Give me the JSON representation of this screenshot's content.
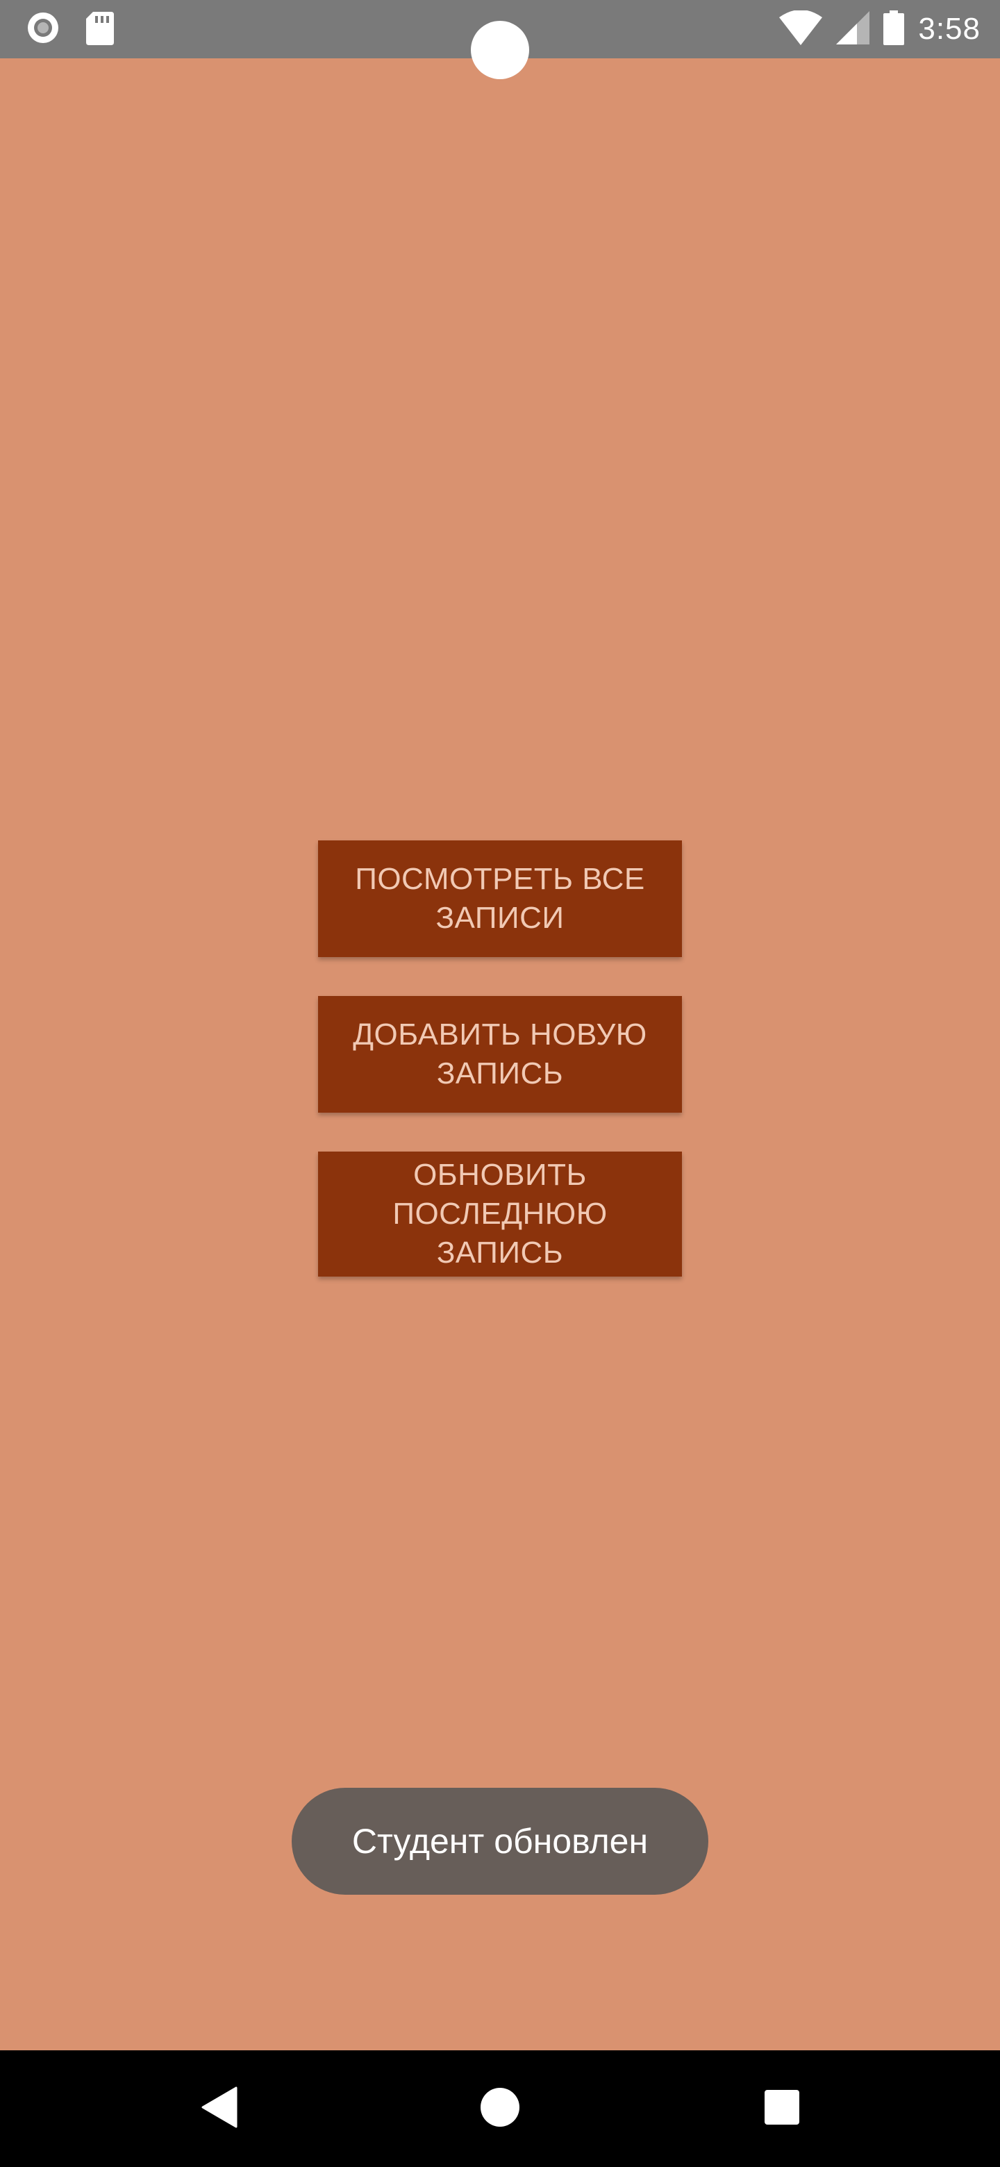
{
  "status_bar": {
    "time": "3:58",
    "icons": [
      "sync-icon",
      "sd-card-icon",
      "wifi-icon",
      "signal-icon",
      "battery-icon"
    ]
  },
  "main": {
    "buttons": [
      {
        "label": "Посмотреть все записи"
      },
      {
        "label": "Добавить новую запись"
      },
      {
        "label": "Обновить последнюю запись"
      }
    ]
  },
  "toast": {
    "message": "Студент обновлен"
  },
  "nav_bar": {
    "icons": [
      "back-icon",
      "home-icon",
      "recents-icon"
    ]
  },
  "colors": {
    "background": "#d99270",
    "button": "#8b330c",
    "button_text": "#f1c9b4",
    "toast": "#675e59",
    "status_bar": "#7a7a7a"
  }
}
